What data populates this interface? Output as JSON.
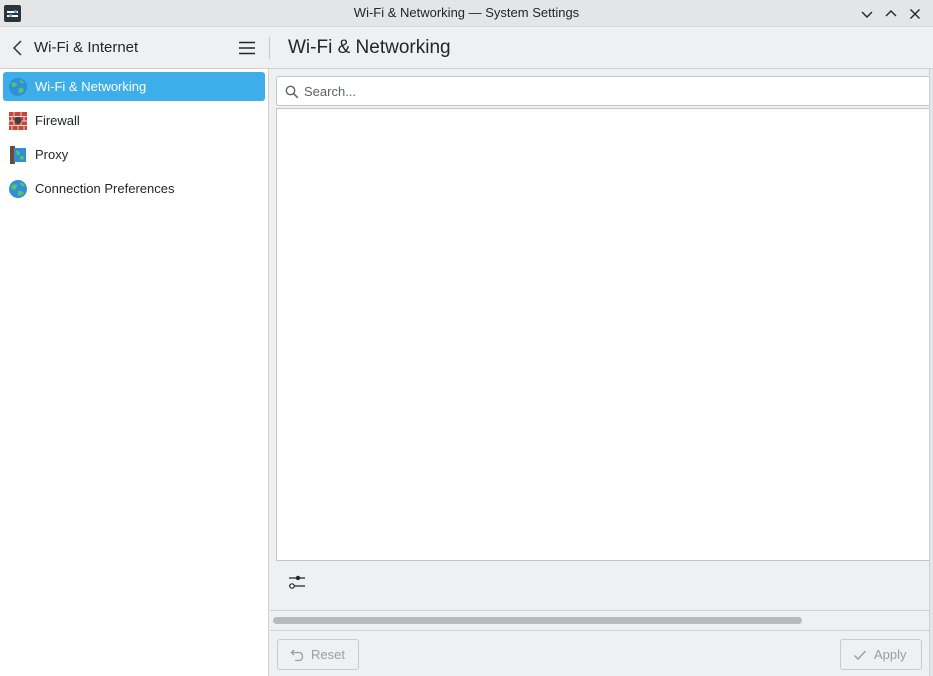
{
  "window": {
    "title": "Wi-Fi & Networking — System Settings",
    "icon": "system-settings-icon",
    "controls": [
      "minimize-icon",
      "maximize-icon",
      "close-icon"
    ]
  },
  "header": {
    "section_title": "Wi-Fi & Internet",
    "page_title": "Wi-Fi & Networking",
    "back_icon": "chevron-left-icon",
    "menu_icon": "hamburger-menu-icon"
  },
  "sidebar": {
    "items": [
      {
        "label": "Wi-Fi & Networking",
        "icon": "globe-network-icon",
        "active": true
      },
      {
        "label": "Firewall",
        "icon": "firewall-icon",
        "active": false
      },
      {
        "label": "Proxy",
        "icon": "proxy-icon",
        "active": false
      },
      {
        "label": "Connection Preferences",
        "icon": "globe-icon",
        "active": false
      }
    ]
  },
  "main": {
    "search": {
      "placeholder": "Search...",
      "value": ""
    },
    "config_icon": "sliders-icon"
  },
  "footer": {
    "reset_label": "Reset",
    "apply_label": "Apply",
    "reset_icon": "undo-icon",
    "apply_icon": "checkmark-icon"
  },
  "colors": {
    "accent": "#3daee9",
    "window_bg": "#eff0f1",
    "view_bg": "#ffffff",
    "text": "#232629",
    "disabled_text": "#9a9ea2"
  }
}
